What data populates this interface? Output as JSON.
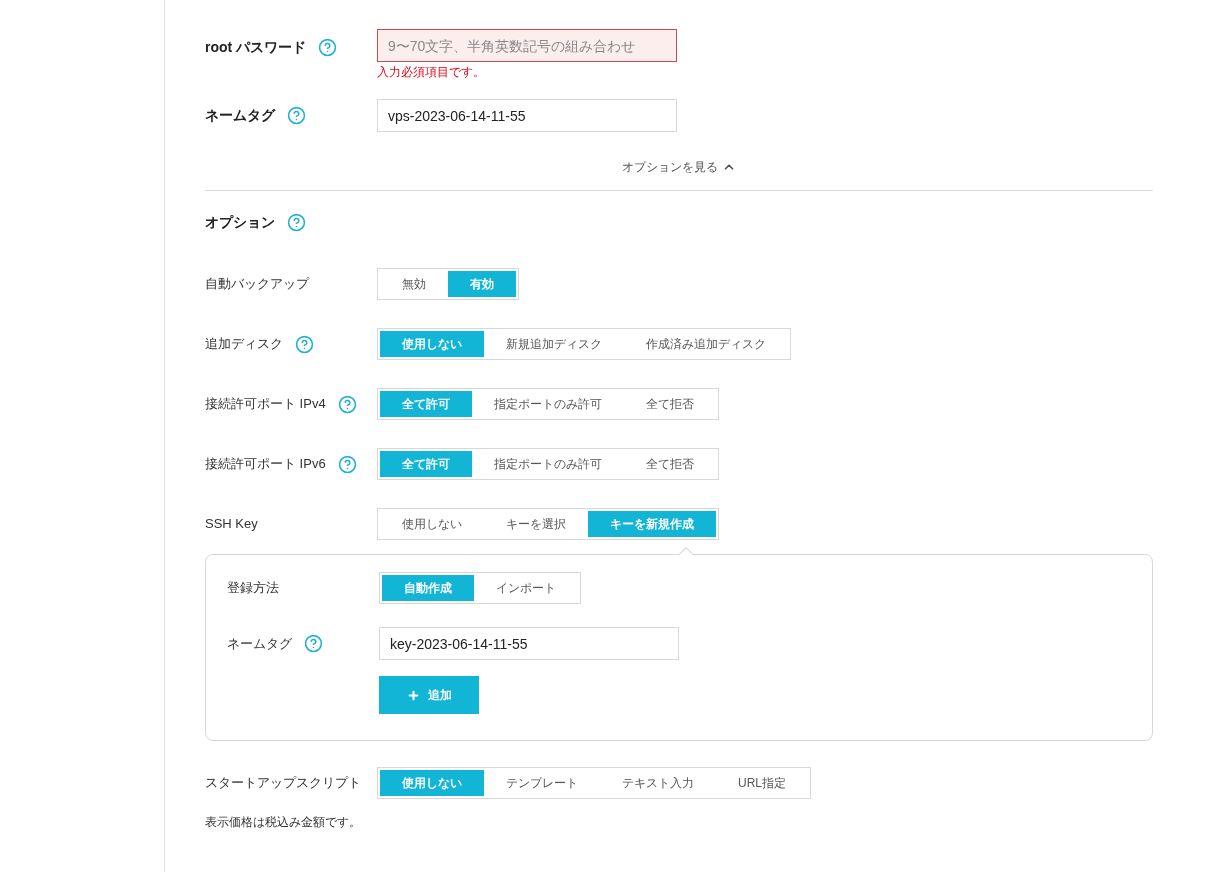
{
  "root_password": {
    "label": "root パスワード",
    "help": true,
    "placeholder": "9〜70文字、半角英数記号の組み合わせ",
    "error": "入力必須項目です。"
  },
  "name_tag": {
    "label": "ネームタグ",
    "help": true,
    "value": "vps-2023-06-14-11-55"
  },
  "options_toggle": {
    "label": "オプションを見る",
    "expanded": true
  },
  "options": {
    "title": "オプション",
    "help": true,
    "rows": [
      {
        "label": "自動バックアップ",
        "help": false,
        "segments": [
          {
            "label": "無効",
            "selected": false
          },
          {
            "label": "有効",
            "selected": true
          }
        ]
      },
      {
        "label": "追加ディスク",
        "help": true,
        "segments": [
          {
            "label": "使用しない",
            "selected": true
          },
          {
            "label": "新規追加ディスク",
            "selected": false
          },
          {
            "label": "作成済み追加ディスク",
            "selected": false
          }
        ]
      },
      {
        "label": "接続許可ポート IPv4",
        "help": true,
        "segments": [
          {
            "label": "全て許可",
            "selected": true
          },
          {
            "label": "指定ポートのみ許可",
            "selected": false
          },
          {
            "label": "全て拒否",
            "selected": false
          }
        ]
      },
      {
        "label": "接続許可ポート IPv6",
        "help": true,
        "segments": [
          {
            "label": "全て許可",
            "selected": true
          },
          {
            "label": "指定ポートのみ許可",
            "selected": false
          },
          {
            "label": "全て拒否",
            "selected": false
          }
        ]
      },
      {
        "label": "SSH Key",
        "help": false,
        "segments": [
          {
            "label": "使用しない",
            "selected": false
          },
          {
            "label": "キーを選択",
            "selected": false
          },
          {
            "label": "キーを新規作成",
            "selected": true
          }
        ]
      }
    ]
  },
  "ssh_panel": {
    "method": {
      "label": "登録方法",
      "segments": [
        {
          "label": "自動作成",
          "selected": true
        },
        {
          "label": "インポート",
          "selected": false
        }
      ]
    },
    "name_tag": {
      "label": "ネームタグ",
      "help": true,
      "value": "key-2023-06-14-11-55"
    },
    "add_button": "追加"
  },
  "startup": {
    "label": "スタートアップスクリプト",
    "segments": [
      {
        "label": "使用しない",
        "selected": true
      },
      {
        "label": "テンプレート",
        "selected": false
      },
      {
        "label": "テキスト入力",
        "selected": false
      },
      {
        "label": "URL指定",
        "selected": false
      }
    ]
  },
  "note": "表示価格は税込み金額です。"
}
